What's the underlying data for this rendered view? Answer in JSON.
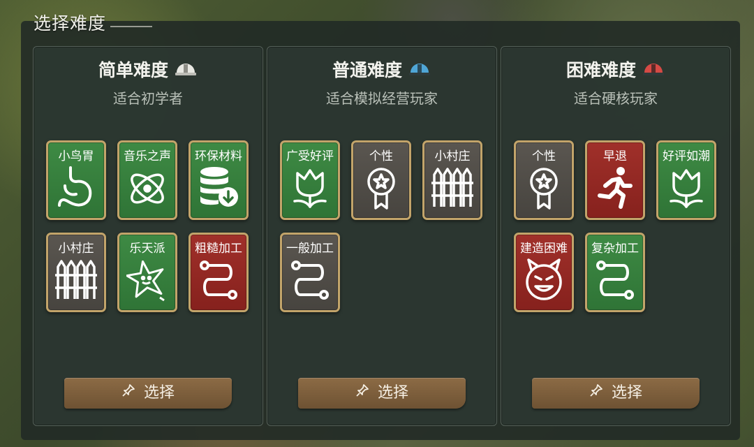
{
  "title": "选择难度",
  "select_label": "选择",
  "panels": [
    {
      "title": "简单难度",
      "subtitle": "适合初学者",
      "icon": "helmet-white-icon",
      "cards": [
        {
          "label": "小鸟胃",
          "color": "green",
          "icon": "stomach-icon"
        },
        {
          "label": "音乐之声",
          "color": "green",
          "icon": "atom-music-icon"
        },
        {
          "label": "环保材料",
          "color": "green",
          "icon": "database-download-icon"
        },
        {
          "label": "小村庄",
          "color": "gray",
          "icon": "fence-icon"
        },
        {
          "label": "乐天派",
          "color": "green",
          "icon": "happy-star-icon"
        },
        {
          "label": "粗糙加工",
          "color": "red",
          "icon": "route-icon"
        }
      ]
    },
    {
      "title": "普通难度",
      "subtitle": "适合模拟经营玩家",
      "icon": "helmet-blue-icon",
      "cards": [
        {
          "label": "广受好评",
          "color": "green",
          "icon": "tulip-icon"
        },
        {
          "label": "个性",
          "color": "gray",
          "icon": "award-ribbon-icon"
        },
        {
          "label": "小村庄",
          "color": "gray",
          "icon": "fence-icon"
        },
        {
          "label": "一般加工",
          "color": "gray",
          "icon": "route-icon"
        }
      ]
    },
    {
      "title": "困难难度",
      "subtitle": "适合硬核玩家",
      "icon": "helmet-red-icon",
      "cards": [
        {
          "label": "个性",
          "color": "gray",
          "icon": "award-ribbon-icon"
        },
        {
          "label": "早退",
          "color": "red",
          "icon": "running-man-icon"
        },
        {
          "label": "好评如潮",
          "color": "green",
          "icon": "tulip-icon"
        },
        {
          "label": "建造困难",
          "color": "red",
          "icon": "devil-face-icon"
        },
        {
          "label": "复杂加工",
          "color": "green",
          "icon": "route-icon"
        }
      ]
    }
  ],
  "colors": {
    "card_green": "#3e8a44",
    "card_gray": "#5a5650",
    "card_red": "#a0302a",
    "card_border": "#c2a46a",
    "button": "#8c6b45",
    "helmet_blue": "#4fa6d6",
    "helmet_red": "#d64a45"
  }
}
